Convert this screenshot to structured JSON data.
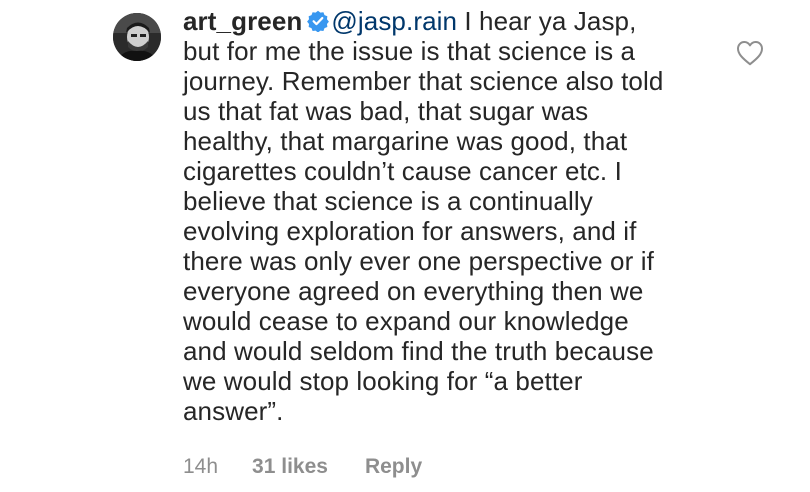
{
  "comment": {
    "username": "art_green",
    "verified_icon": "verified-badge-icon",
    "mention": "@jasp.rain",
    "lines": {
      "l1": " I hear ya Jasp,",
      "l2": "but for me the issue is that science is a",
      "l3": "journey. Remember that science also told",
      "l4": "us that fat was bad, that sugar was",
      "l5": "healthy, that margarine was good, that",
      "l6": "cigarettes couldn’t cause cancer etc. I",
      "l7": "believe that science is a continually",
      "l8": "evolving exploration for answers, and if",
      "l9": "there was only ever one perspective or if",
      "l10": "everyone agreed on everything then we",
      "l11": "would cease to expand our knowledge",
      "l12": "and would seldom find the truth because",
      "l13": "we would stop looking for “a better",
      "l14": "answer”."
    },
    "time": "14h",
    "likes": "31 likes",
    "reply_label": "Reply",
    "like_icon": "heart-outline-icon"
  },
  "colors": {
    "text": "#262626",
    "mention": "#00376b",
    "meta": "#8e8e8e",
    "verified": "#3897f0",
    "heart_stroke": "#8e8e8e"
  }
}
